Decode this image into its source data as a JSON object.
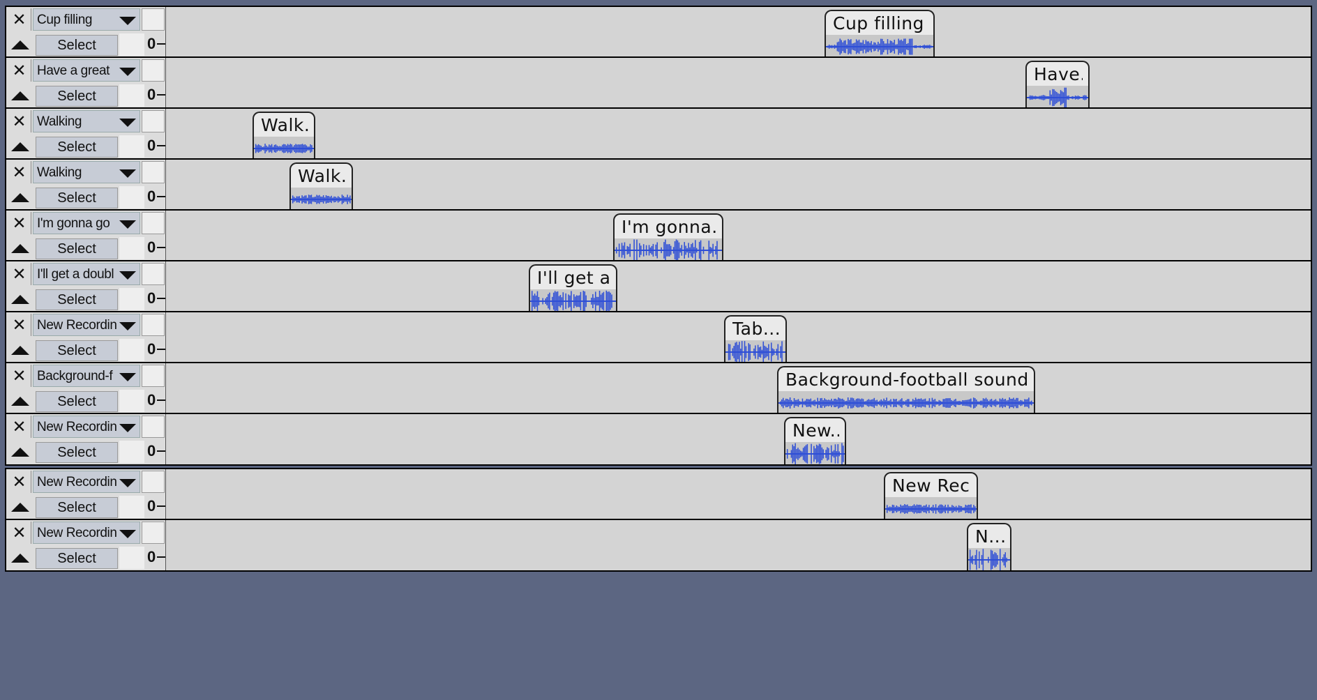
{
  "app": {
    "accent_color": "#2f4fd6",
    "background_color": "#5c6682"
  },
  "track_controls": {
    "close_glyph": "✕",
    "select_label": "Select",
    "ruler_zero": "0"
  },
  "tracks": [
    {
      "name": "Cup filling",
      "clip_title": "Cup filling"
    },
    {
      "name": "Have a great",
      "clip_title": "Have..."
    },
    {
      "name": "Walking",
      "clip_title": "Walk..."
    },
    {
      "name": "Walking",
      "clip_title": "Walk..."
    },
    {
      "name": "I'm gonna go",
      "clip_title": "I'm gonna..."
    },
    {
      "name": "I'll get a doubl",
      "clip_title": "I'll get a..."
    },
    {
      "name": "New Recordin",
      "clip_title": "Tab..."
    },
    {
      "name": "Background-f",
      "clip_title": "Background-football sounds"
    },
    {
      "name": "New Recordin",
      "clip_title": "New..."
    },
    {
      "name": "New Recordin",
      "clip_title": "New Rec..."
    },
    {
      "name": "New Recordin",
      "clip_title": "N..."
    }
  ]
}
